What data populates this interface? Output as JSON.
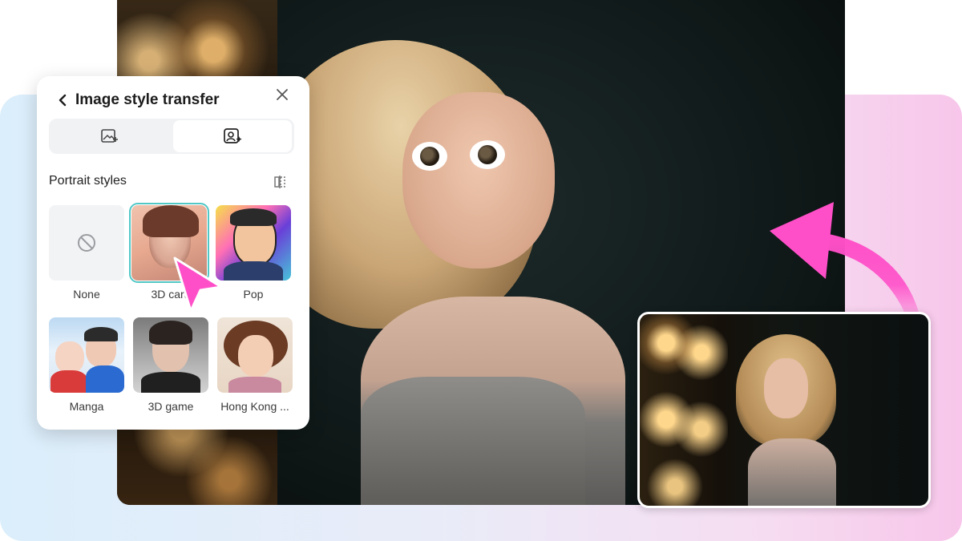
{
  "panel": {
    "title": "Image style transfer",
    "tabs": [
      {
        "icon": "image-add-icon",
        "active": false
      },
      {
        "icon": "portrait-style-icon",
        "active": true
      }
    ],
    "section_title": "Portrait styles",
    "styles": [
      {
        "label": "None",
        "selected": false
      },
      {
        "label": "3D cart",
        "selected": true
      },
      {
        "label": "Pop",
        "selected": false
      },
      {
        "label": "Manga",
        "selected": false
      },
      {
        "label": "3D game",
        "selected": false
      },
      {
        "label": "Hong Kong ...",
        "selected": false
      }
    ]
  },
  "colors": {
    "accent_selected": "#52c8c6",
    "cursor_pink": "#ff4fc8",
    "arrow_pink": "#ff4fc8",
    "bg_left": "#dbeefb",
    "bg_right": "#f7c6ea"
  }
}
